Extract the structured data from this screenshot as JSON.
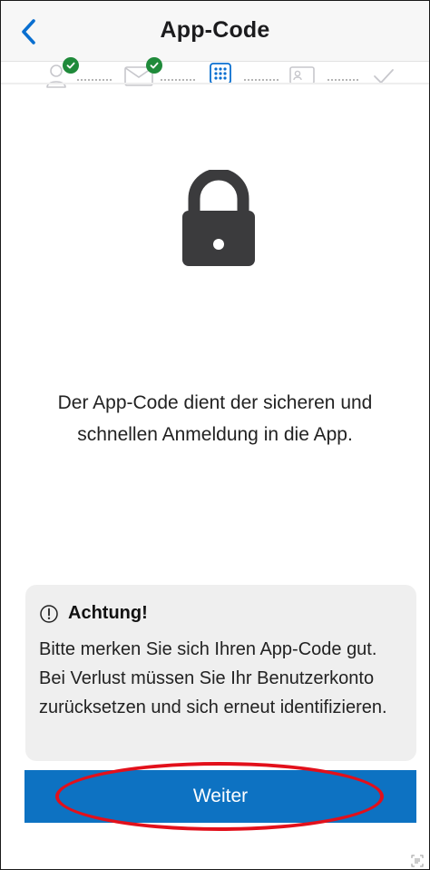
{
  "header": {
    "title": "App-Code"
  },
  "steps": [
    {
      "name": "profile",
      "status": "done"
    },
    {
      "name": "email",
      "status": "done"
    },
    {
      "name": "app-code",
      "status": "current"
    },
    {
      "name": "id-card",
      "status": "pending"
    },
    {
      "name": "finish",
      "status": "pending"
    }
  ],
  "main": {
    "description": "Der App-Code dient der sicheren und schnellen Anmeldung in die App."
  },
  "warning": {
    "icon": "info-circle-icon",
    "title": "Achtung!",
    "text": "Bitte merken Sie sich Ihren App-Code gut. Bei Verlust müssen Sie Ihr Benutzerkonto zurücksetzen und sich erneut identifizieren."
  },
  "action": {
    "continue_label": "Weiter"
  },
  "colors": {
    "accent": "#0d72c2",
    "success": "#1f8a3a",
    "highlight": "#e2101b"
  }
}
